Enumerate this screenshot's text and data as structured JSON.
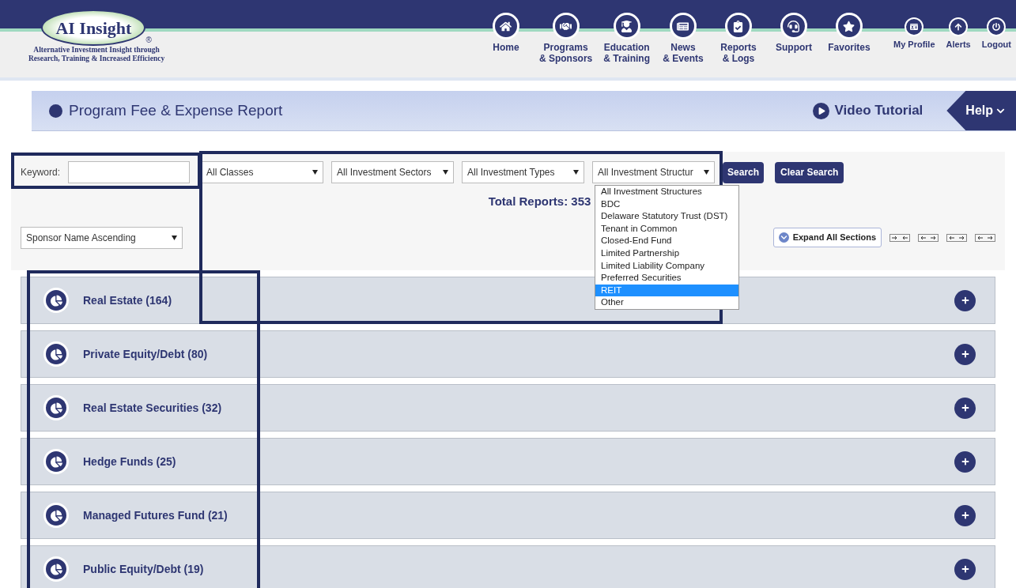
{
  "logo": {
    "brand": "AI Insight",
    "mark": "®",
    "tagline": [
      "Alternative Investment Insight through",
      "Research, Training & Increased Efficiency"
    ]
  },
  "nav": [
    {
      "lines": [
        "Home"
      ]
    },
    {
      "lines": [
        "Programs",
        "& Sponsors"
      ]
    },
    {
      "lines": [
        "Education",
        "& Training"
      ]
    },
    {
      "lines": [
        "News",
        "& Events"
      ]
    },
    {
      "lines": [
        "Reports",
        "& Logs"
      ]
    },
    {
      "lines": [
        "Support"
      ]
    },
    {
      "lines": [
        "Favorites"
      ]
    }
  ],
  "user_nav": [
    {
      "label": "My Profile"
    },
    {
      "label": "Alerts"
    },
    {
      "label": "Logout"
    }
  ],
  "title_bar": {
    "title": "Program Fee & Expense Report",
    "video": "Video Tutorial",
    "help": "Help"
  },
  "filters": {
    "keyword_label": "Keyword:",
    "selects": [
      "All Classes",
      "All Investment Sectors",
      "All Investment Types",
      "All Investment Structur"
    ],
    "search": "Search",
    "clear": "Clear Search",
    "sort": "Sponsor Name Ascending",
    "total": "Total Reports: 353",
    "expand": "Expand All Sections"
  },
  "structure_options": [
    {
      "label": "All Investment Structures",
      "selected": false
    },
    {
      "label": "BDC",
      "selected": false
    },
    {
      "label": "Delaware Statutory Trust (DST)",
      "selected": false
    },
    {
      "label": "Tenant in Common",
      "selected": false
    },
    {
      "label": "Closed-End Fund",
      "selected": false
    },
    {
      "label": "Limited Partnership",
      "selected": false
    },
    {
      "label": "Limited Liability Company",
      "selected": false
    },
    {
      "label": "Preferred Securities",
      "selected": false
    },
    {
      "label": "REIT",
      "selected": true
    },
    {
      "label": "Other",
      "selected": false
    }
  ],
  "sections": [
    {
      "label": "Real Estate (164)",
      "expanded": false
    },
    {
      "label": "Private Equity/Debt (80)",
      "expanded": false
    },
    {
      "label": "Real Estate Securities (32)",
      "expanded": false
    },
    {
      "label": "Hedge Funds (25)",
      "expanded": false
    },
    {
      "label": "Managed Futures Fund (21)",
      "expanded": false
    },
    {
      "label": "Public Equity/Debt (19)",
      "expanded": false
    }
  ]
}
